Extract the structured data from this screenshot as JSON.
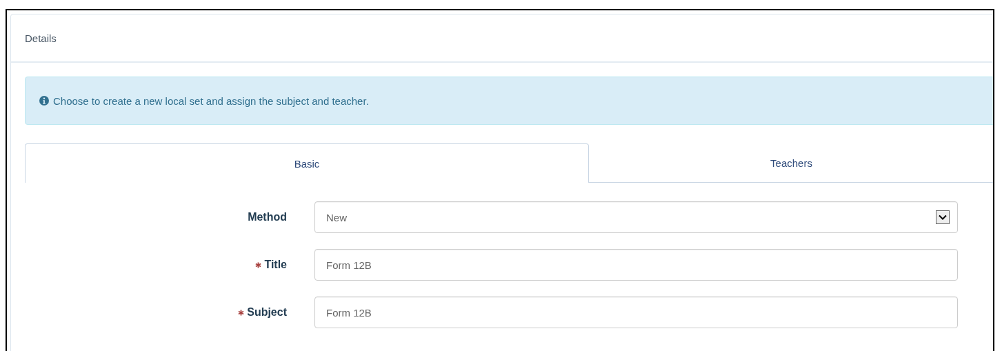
{
  "panel": {
    "title": "Details"
  },
  "alert": {
    "text": "Choose to create a new local set and assign the subject and teacher."
  },
  "tabs": [
    {
      "label": "Basic",
      "selected": true
    },
    {
      "label": "Teachers",
      "selected": false
    }
  ],
  "fields": [
    {
      "kind": "select",
      "label": "Method",
      "required": false,
      "value": "New"
    },
    {
      "kind": "text",
      "label": "Title",
      "required": true,
      "value": "Form 12B"
    },
    {
      "kind": "text",
      "label": "Subject",
      "required": true,
      "value": "Form 12B"
    }
  ]
}
